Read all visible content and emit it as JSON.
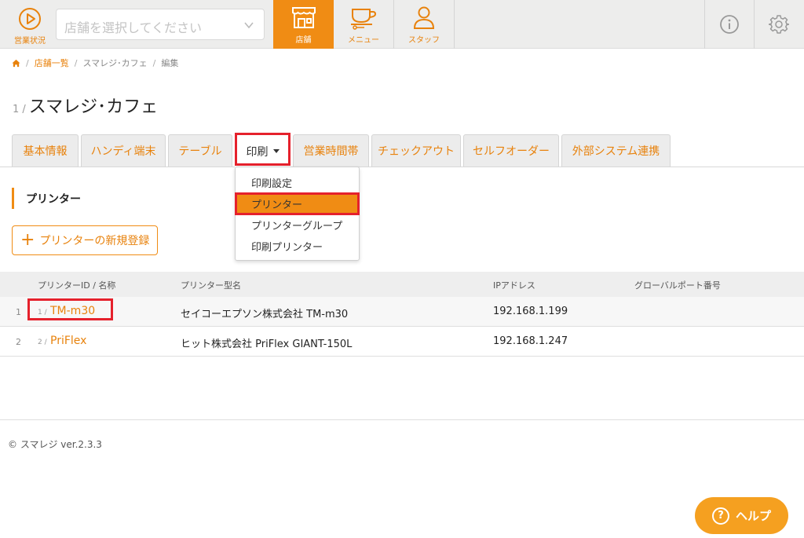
{
  "topbar": {
    "status_label": "営業状況",
    "store_select_placeholder": "店舗を選択してください",
    "nav": [
      {
        "label": "店舗"
      },
      {
        "label": "メニュー"
      },
      {
        "label": "スタッフ"
      }
    ],
    "accent_color": "#f08c14"
  },
  "breadcrumb": {
    "items": [
      "店舗一覧",
      "スマレジ･カフェ",
      "編集"
    ],
    "sep": "/"
  },
  "page": {
    "number": "1 /",
    "title": "スマレジ･カフェ"
  },
  "tabs": [
    {
      "label": "基本情報"
    },
    {
      "label": "ハンディ端末"
    },
    {
      "label": "テーブル"
    },
    {
      "label": "印刷"
    },
    {
      "label": "営業時間帯"
    },
    {
      "label": "チェックアウト"
    },
    {
      "label": "セルフオーダー"
    },
    {
      "label": "外部システム連携"
    }
  ],
  "dropdown": {
    "items": [
      "印刷設定",
      "プリンター",
      "プリンターグループ",
      "印刷プリンター"
    ]
  },
  "section": {
    "heading": "プリンター",
    "add_button": "プリンターの新規登録",
    "add_symbol": "+"
  },
  "table": {
    "headers": [
      "プリンターID / 名称",
      "プリンター型名",
      "IPアドレス",
      "グローバルポート番号"
    ],
    "rows": [
      {
        "index": "1",
        "id": "1 /",
        "name": "TM-m30",
        "model": "セイコーエプソン株式会社 TM-m30",
        "ip": "192.168.1.199",
        "port": ""
      },
      {
        "index": "2",
        "id": "2 /",
        "name": "PriFlex",
        "model": "ヒット株式会社 PriFlex GIANT-150L",
        "ip": "192.168.1.247",
        "port": ""
      }
    ]
  },
  "footer": {
    "text": "© スマレジ ver.2.3.3"
  },
  "help": {
    "label": "ヘルプ",
    "symbol": "?"
  }
}
